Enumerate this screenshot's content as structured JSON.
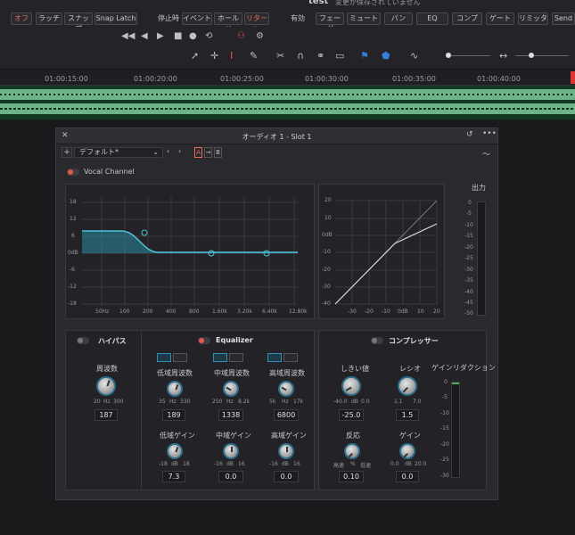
{
  "project": {
    "name": "test",
    "unsaved": "変更が保存されていません"
  },
  "topbar": {
    "off": "オフ",
    "latch": "ラッチ",
    "snap": "スナップ",
    "snap_latch": "Snap Latch",
    "on_stop": "停止時",
    "event": "イベント",
    "hold": "ホールド",
    "return": "リターン",
    "enabled": "有効",
    "fader": "フェーダ",
    "mute": "ミュート",
    "pan": "パン",
    "eq": "EQ",
    "comp": "コンプ",
    "gate": "ゲート",
    "limiter": "リミッタ",
    "send": "Send"
  },
  "ruler": [
    "01:00:15:00",
    "01:00:20:00",
    "01:00:25:00",
    "01:00:30:00",
    "01:00:35:00",
    "01:00:40:00"
  ],
  "plugin": {
    "title": "オーディオ 1 - Slot 1",
    "preset": "デフォルト*",
    "a": "A",
    "b": "B",
    "channel": "Vocal Channel",
    "output": "出力",
    "eq_y": [
      "18",
      "12",
      "6",
      "0dB",
      "-6",
      "-12",
      "-18"
    ],
    "eq_x": [
      "50Hz",
      "100",
      "200",
      "400",
      "800",
      "1.60k",
      "3.20k",
      "6.40k",
      "12.80k"
    ],
    "comp_y": [
      "20",
      "10",
      "0dB",
      "-10",
      "-20",
      "-30",
      "-40"
    ],
    "comp_x": [
      "-30",
      "-20",
      "-10",
      "0dB",
      "10",
      "20"
    ],
    "meter_scale": [
      "0",
      "-5",
      "-10",
      "-15",
      "-20",
      "-25",
      "-30",
      "-35",
      "-40",
      "-45",
      "-50"
    ],
    "highpass": {
      "label": "ハイパス",
      "freq_label": "周波数",
      "min": "20",
      "unit": "Hz",
      "max": "300",
      "value": "187"
    },
    "equalizer": {
      "label": "Equalizer",
      "low_freq": {
        "label": "低域周波数",
        "min": "35",
        "unit": "Hz",
        "max": "330",
        "value": "189"
      },
      "mid_freq": {
        "label": "中域周波数",
        "min": "250",
        "unit": "Hz",
        "max": "8.2k",
        "value": "1338"
      },
      "high_freq": {
        "label": "高域周波数",
        "min": "5k",
        "unit": "Hz",
        "max": "17k",
        "value": "6800"
      },
      "low_gain": {
        "label": "低域ゲイン",
        "min": "-18",
        "unit": "dB",
        "max": "18",
        "value": "7.3"
      },
      "mid_gain": {
        "label": "中域ゲイン",
        "min": "-16",
        "unit": "dB",
        "max": "16",
        "value": "0.0"
      },
      "high_gain": {
        "label": "高域ゲイン",
        "min": "-16",
        "unit": "dB",
        "max": "16",
        "value": "0.0"
      }
    },
    "compressor": {
      "label": "コンプレッサー",
      "threshold": {
        "label": "しきい値",
        "min": "-40.0",
        "unit": "dB",
        "max": "0.0",
        "value": "-25.0"
      },
      "ratio": {
        "label": "レシオ",
        "min": "1.1",
        "max": "7.0",
        "value": "1.5"
      },
      "response": {
        "label": "反応",
        "min": "高速",
        "unit": "%",
        "max": "低速",
        "value": "0.10"
      },
      "gain": {
        "label": "ゲイン",
        "min": "0.0",
        "unit": "dB",
        "max": "20.0",
        "value": "0.0"
      },
      "gr_label": "ゲインリダクション",
      "gr_scale": [
        "0",
        "-5",
        "-10",
        "-15",
        "-20",
        "-25",
        "-30"
      ]
    }
  }
}
